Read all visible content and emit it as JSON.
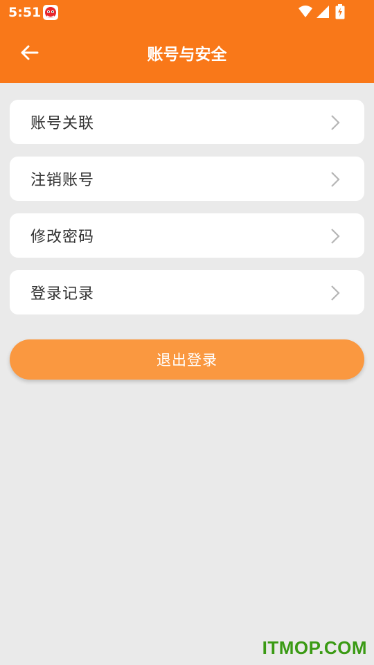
{
  "status_bar": {
    "time": "5:51"
  },
  "header": {
    "title": "账号与安全"
  },
  "menu": {
    "items": [
      {
        "label": "账号关联"
      },
      {
        "label": "注销账号"
      },
      {
        "label": "修改密码"
      },
      {
        "label": "登录记录"
      }
    ]
  },
  "logout_button": {
    "label": "退出登录"
  },
  "watermark": {
    "text": "ITMOP.COM"
  },
  "colors": {
    "brand": "#f97819",
    "button": "#fa9840",
    "background": "#eaeaea",
    "watermark": "#3a9a14"
  },
  "icons": [
    "app-notification-icon",
    "wifi-icon",
    "signal-icon",
    "battery-charging-icon",
    "back-arrow-icon",
    "chevron-right-icon"
  ]
}
